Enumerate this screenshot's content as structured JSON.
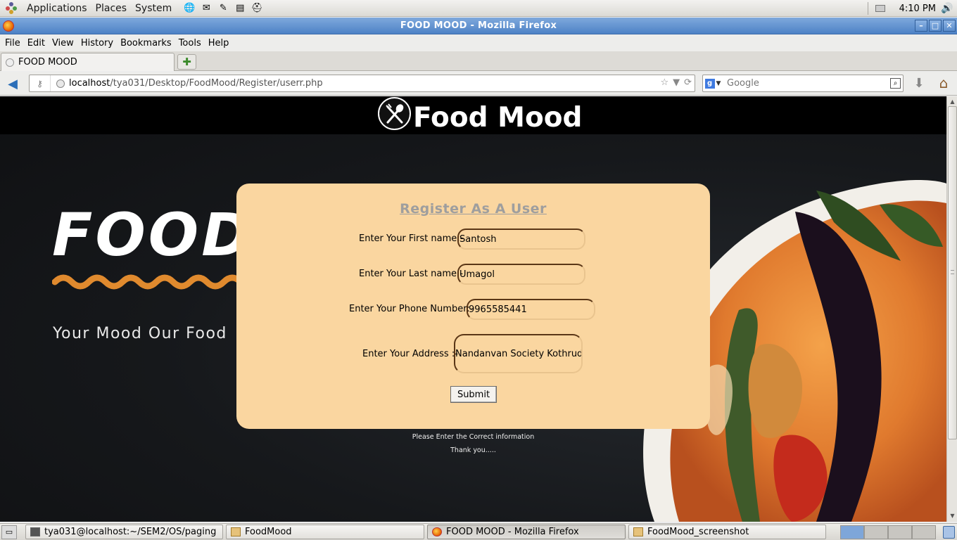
{
  "panel": {
    "menus": [
      "Applications",
      "Places",
      "System"
    ],
    "clock": "4:10 PM"
  },
  "window": {
    "title": "FOOD MOOD - Mozilla Firefox",
    "controls": [
      "minimize",
      "maximize",
      "close"
    ]
  },
  "menubar": [
    "File",
    "Edit",
    "View",
    "History",
    "Bookmarks",
    "Tools",
    "Help"
  ],
  "tab": {
    "label": "FOOD MOOD"
  },
  "urlbar": {
    "host": "localhost",
    "path": "/tya031/Desktop/FoodMood/Register/userr.php"
  },
  "search": {
    "placeholder": "Google"
  },
  "site": {
    "title": "Food Mood",
    "hero_word": "FOOD",
    "tagline": "Your Mood Our Food"
  },
  "form": {
    "heading": "Register As A User",
    "first_name_label": "Enter Your First name:-",
    "first_name_value": "Santosh",
    "last_name_label": "Enter Your Last name:-",
    "last_name_value": "Umagol",
    "phone_label": "Enter Your Phone Number:-",
    "phone_value": "9965585441",
    "address_label": "Enter Your Address :-",
    "address_value": "Nandanvan Society Kothrud",
    "submit_label": "Submit"
  },
  "notes": {
    "line1": "Please Enter the Correct information",
    "line2": "Thank you....."
  },
  "taskbar": {
    "items": [
      {
        "label": "tya031@localhost:~/SEM2/OS/paging",
        "icon": "terminal-icon",
        "active": false
      },
      {
        "label": "FoodMood",
        "icon": "folder-icon",
        "active": false
      },
      {
        "label": "FOOD MOOD - Mozilla Firefox",
        "icon": "firefox-icon",
        "active": true
      },
      {
        "label": "FoodMood_screenshot",
        "icon": "folder-icon",
        "active": false
      }
    ]
  },
  "colors": {
    "card": "#fad6a0",
    "wave": "#e08a2e",
    "titlebar": "#4d82c6",
    "heading": "#9e9e9e"
  }
}
